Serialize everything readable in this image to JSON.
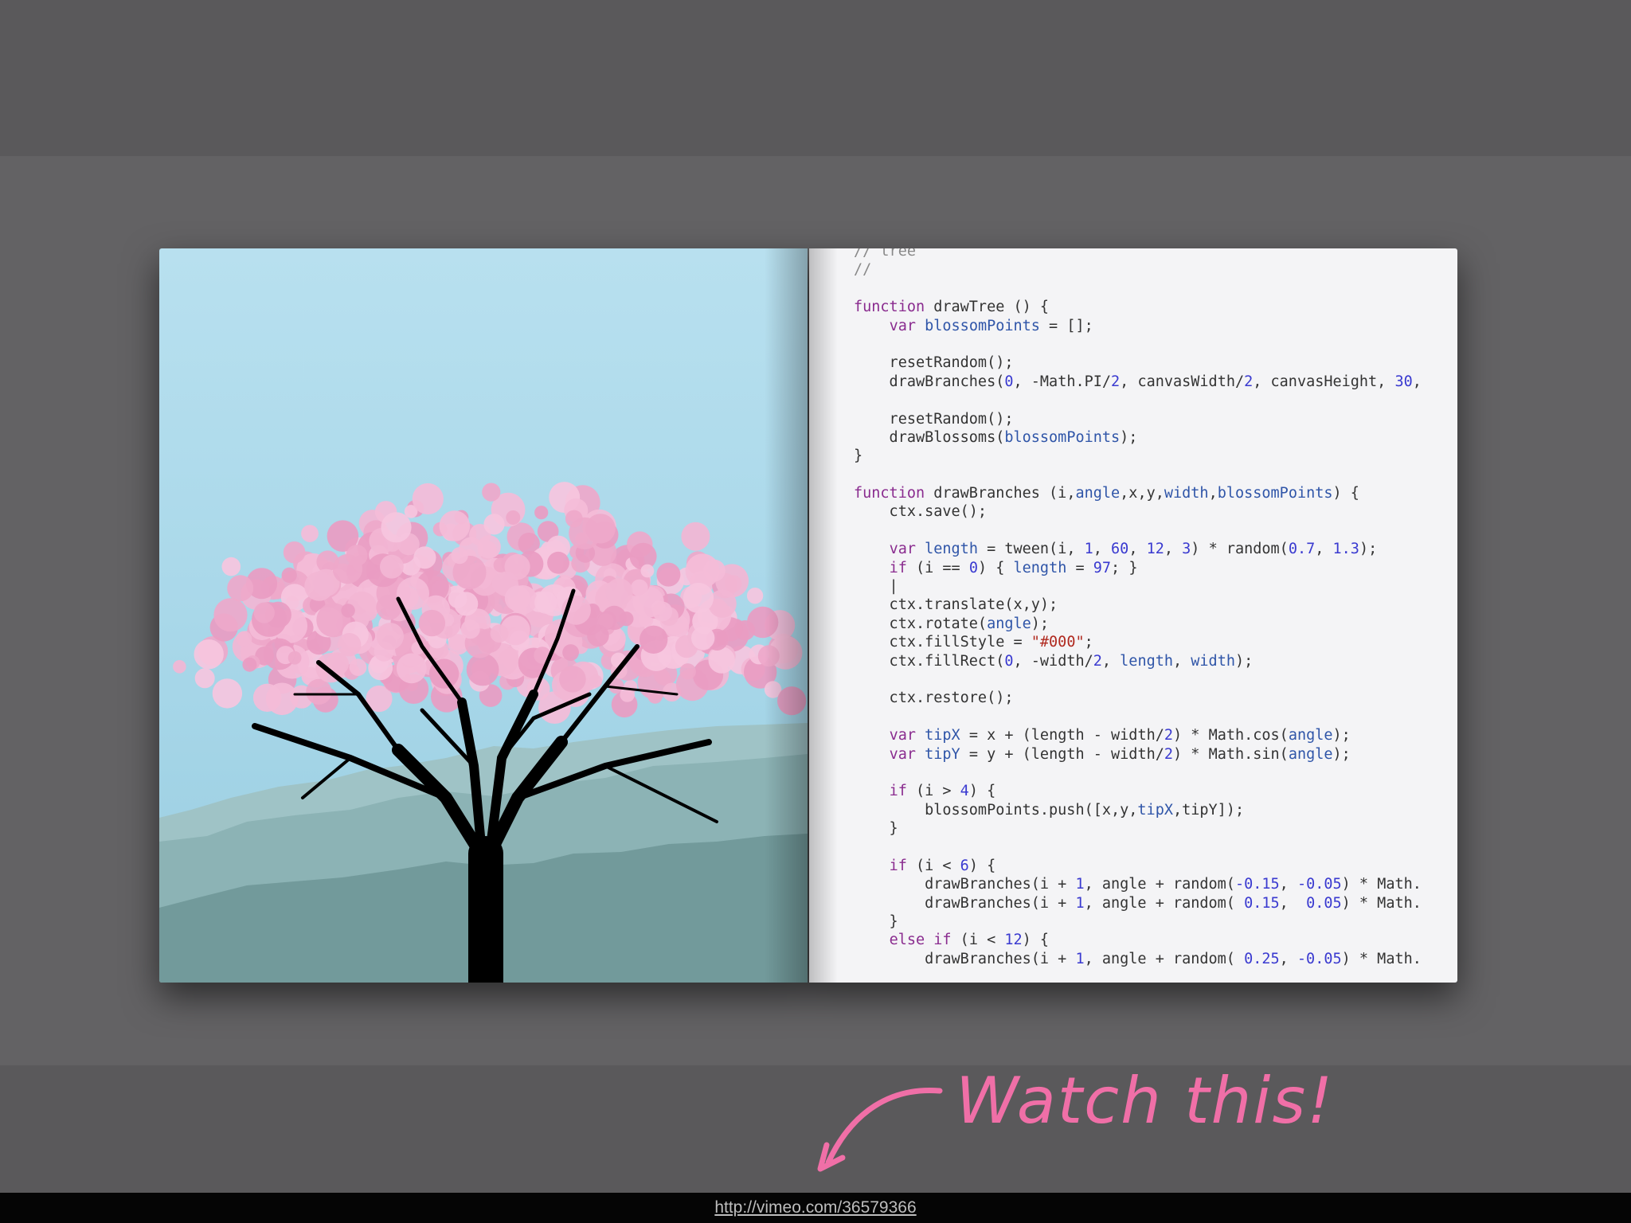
{
  "code_lines": [
    {
      "text": "// tree",
      "type": "comment"
    },
    {
      "text": "//",
      "type": "comment"
    },
    {
      "text": "",
      "type": "blank"
    },
    {
      "text": "function drawTree () {",
      "type": "code"
    },
    {
      "text": "    var blossomPoints = [];",
      "type": "code"
    },
    {
      "text": "",
      "type": "blank"
    },
    {
      "text": "    resetRandom();",
      "type": "code"
    },
    {
      "text": "    drawBranches(0, -Math.PI/2, canvasWidth/2, canvasHeight, 30,",
      "type": "code"
    },
    {
      "text": "",
      "type": "blank"
    },
    {
      "text": "    resetRandom();",
      "type": "code"
    },
    {
      "text": "    drawBlossoms(blossomPoints);",
      "type": "code"
    },
    {
      "text": "}",
      "type": "code"
    },
    {
      "text": "",
      "type": "blank"
    },
    {
      "text": "function drawBranches (i,angle,x,y,width,blossomPoints) {",
      "type": "code"
    },
    {
      "text": "    ctx.save();",
      "type": "code"
    },
    {
      "text": "",
      "type": "blank"
    },
    {
      "text": "    var length = tween(i, 1, 60, 12, 3) * random(0.7, 1.3);",
      "type": "code"
    },
    {
      "text": "    if (i == 0) { length = 97; }",
      "type": "code"
    },
    {
      "text": "    |",
      "type": "code"
    },
    {
      "text": "    ctx.translate(x,y);",
      "type": "code"
    },
    {
      "text": "    ctx.rotate(angle);",
      "type": "code"
    },
    {
      "text": "    ctx.fillStyle = \"#000\";",
      "type": "code"
    },
    {
      "text": "    ctx.fillRect(0, -width/2, length, width);",
      "type": "code"
    },
    {
      "text": "",
      "type": "blank"
    },
    {
      "text": "    ctx.restore();",
      "type": "code"
    },
    {
      "text": "",
      "type": "blank"
    },
    {
      "text": "    var tipX = x + (length - width/2) * Math.cos(angle);",
      "type": "code"
    },
    {
      "text": "    var tipY = y + (length - width/2) * Math.sin(angle);",
      "type": "code"
    },
    {
      "text": "",
      "type": "blank"
    },
    {
      "text": "    if (i > 4) {",
      "type": "code"
    },
    {
      "text": "        blossomPoints.push([x,y,tipX,tipY]);",
      "type": "code"
    },
    {
      "text": "    }",
      "type": "code"
    },
    {
      "text": "",
      "type": "blank"
    },
    {
      "text": "    if (i < 6) {",
      "type": "code"
    },
    {
      "text": "        drawBranches(i + 1, angle + random(-0.15, -0.05) * Math.",
      "type": "code"
    },
    {
      "text": "        drawBranches(i + 1, angle + random( 0.15,  0.05) * Math.",
      "type": "code"
    },
    {
      "text": "    }",
      "type": "code"
    },
    {
      "text": "    else if (i < 12) {",
      "type": "code"
    },
    {
      "text": "        drawBranches(i + 1, angle + random( 0.25, -0.05) * Math.",
      "type": "code"
    }
  ],
  "annotation": {
    "text": "Watch this!"
  },
  "footer": {
    "url": "http://vimeo.com/36579366"
  },
  "colors": {
    "background": "#5c5b5d",
    "sky": "#b8e0ef",
    "blossom": "#f2b6d4",
    "annotation": "#f06fa7",
    "keyword": "#8a2c8f",
    "number": "#3a3ad0"
  }
}
